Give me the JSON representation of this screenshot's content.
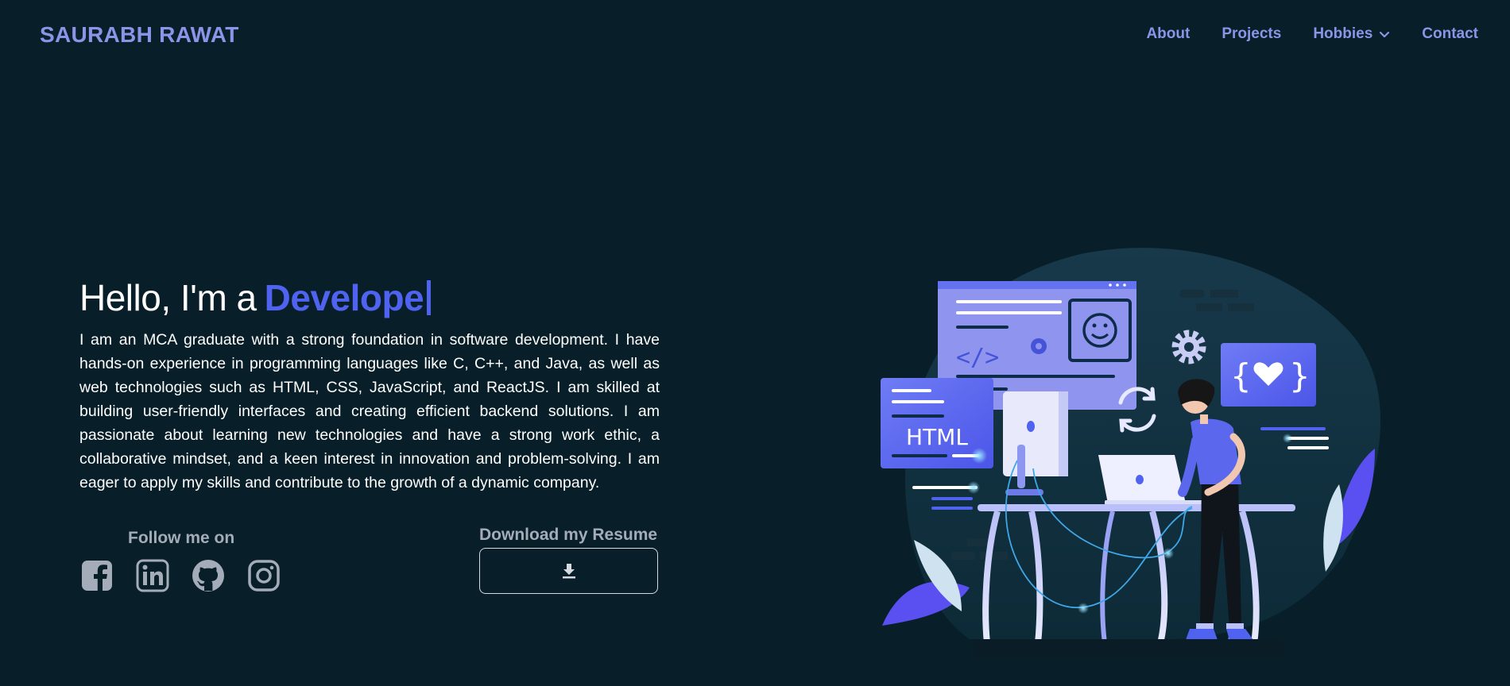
{
  "brand": "SAURABH RAWAT",
  "nav": {
    "about": "About",
    "projects": "Projects",
    "hobbies": "Hobbies",
    "contact": "Contact"
  },
  "hero": {
    "greeting": "Hello, I'm a",
    "role_typed": "Develope",
    "bio": "I am an MCA graduate with a strong foundation in software development. I have hands-on experience in programming languages like C, C++, and Java, as well as web technologies such as HTML, CSS, JavaScript, and ReactJS. I am skilled at building user-friendly interfaces and creating efficient backend solutions. I am passionate about learning new technologies and have a strong work ethic, a collaborative mindset, and a keen interest in innovation and problem-solving. I am eager to apply my skills and contribute to the growth of a dynamic company."
  },
  "social": {
    "label": "Follow me on",
    "icons": [
      "facebook-icon",
      "linkedin-icon",
      "github-icon",
      "instagram-icon"
    ]
  },
  "resume": {
    "label": "Download my Resume",
    "icon": "download-icon"
  },
  "illustration": {
    "html_badge": "HTML"
  },
  "colors": {
    "background": "#081f29",
    "brand": "#8c94e8",
    "accent": "#4f63f0",
    "muted": "#a3acb8"
  }
}
